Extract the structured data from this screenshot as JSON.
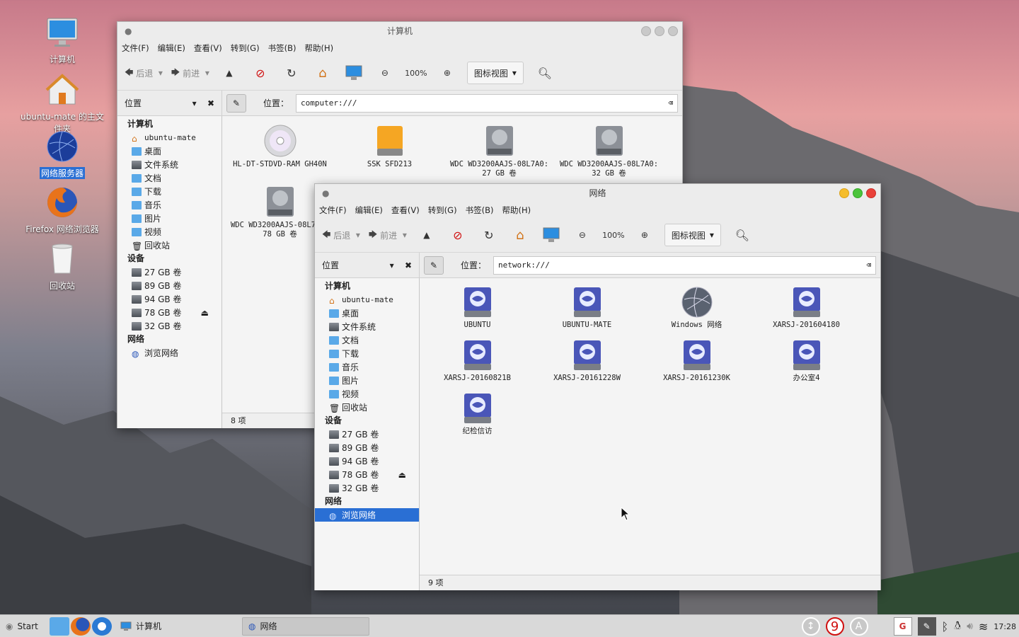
{
  "desktop": {
    "icons": [
      {
        "label": "计算机",
        "icon": "monitor-icon"
      },
      {
        "label": "ubuntu-mate 的主文件夹",
        "icon": "home-folder-icon"
      },
      {
        "label": "网络服务器",
        "icon": "network-globe-icon",
        "selected": true
      },
      {
        "label": "Firefox 网络浏览器",
        "icon": "firefox-icon"
      },
      {
        "label": "回收站",
        "icon": "trash-icon"
      }
    ]
  },
  "win1": {
    "title": "计算机",
    "menu": [
      "文件(F)",
      "编辑(E)",
      "查看(V)",
      "转到(G)",
      "书签(B)",
      "帮助(H)"
    ],
    "toolbar": {
      "back": "后退",
      "forward": "前进",
      "zoom": "100%",
      "view": "图标视图"
    },
    "side_header": "位置",
    "location_label": "位置：",
    "location": "computer:///",
    "sidebar": {
      "computer_header": "计算机",
      "places": [
        "ubuntu-mate",
        "桌面",
        "文件系统",
        "文档",
        "下载",
        "音乐",
        "图片",
        "视频",
        "回收站"
      ],
      "devices_header": "设备",
      "devices": [
        "27 GB 卷",
        "89 GB 卷",
        "94 GB 卷",
        "78 GB 卷",
        "32 GB 卷"
      ],
      "network_header": "网络",
      "network": [
        "浏览网络"
      ]
    },
    "files": [
      {
        "name": "HL-DT-STDVD-RAM GH40N",
        "icon": "optical-disc-icon"
      },
      {
        "name": "SSK SFD213",
        "icon": "usb-drive-icon"
      },
      {
        "name": "WDC WD3200AAJS-08L7A0: 27 GB 卷",
        "icon": "hard-disk-icon"
      },
      {
        "name": "WDC WD3200AAJS-08L7A0: 32 GB 卷",
        "icon": "hard-disk-icon"
      },
      {
        "name": "WDC WD3200AAJS-08L7A0: 78 GB 卷",
        "icon": "hard-disk-icon"
      }
    ],
    "status": "8 项"
  },
  "win2": {
    "title": "网络",
    "menu": [
      "文件(F)",
      "编辑(E)",
      "查看(V)",
      "转到(G)",
      "书签(B)",
      "帮助(H)"
    ],
    "toolbar": {
      "back": "后退",
      "forward": "前进",
      "zoom": "100%",
      "view": "图标视图"
    },
    "side_header": "位置",
    "location_label": "位置：",
    "location": "network:///",
    "sidebar": {
      "computer_header": "计算机",
      "places": [
        "ubuntu-mate",
        "桌面",
        "文件系统",
        "文档",
        "下载",
        "音乐",
        "图片",
        "视频",
        "回收站"
      ],
      "devices_header": "设备",
      "devices": [
        "27 GB 卷",
        "89 GB 卷",
        "94 GB 卷",
        "78 GB 卷",
        "32 GB 卷"
      ],
      "network_header": "网络",
      "network": [
        "浏览网络"
      ]
    },
    "files": [
      {
        "name": "UBUNTU",
        "icon": "server-icon"
      },
      {
        "name": "UBUNTU-MATE",
        "icon": "server-icon"
      },
      {
        "name": "Windows 网络",
        "icon": "network-globe-icon"
      },
      {
        "name": "XARSJ-201604180",
        "icon": "server-icon"
      },
      {
        "name": "XARSJ-20160821B",
        "icon": "server-icon"
      },
      {
        "name": "XARSJ-20161228W",
        "icon": "server-icon"
      },
      {
        "name": "XARSJ-20161230K",
        "icon": "server-icon"
      },
      {
        "name": "办公室4",
        "icon": "server-icon"
      },
      {
        "name": "纪检信访",
        "icon": "server-icon"
      }
    ],
    "status": "9 项"
  },
  "taskbar": {
    "start": "Start",
    "tasks": [
      "计算机",
      "网络"
    ],
    "tray_badge": "9",
    "tray_letter": "A",
    "clock": "17:28"
  }
}
